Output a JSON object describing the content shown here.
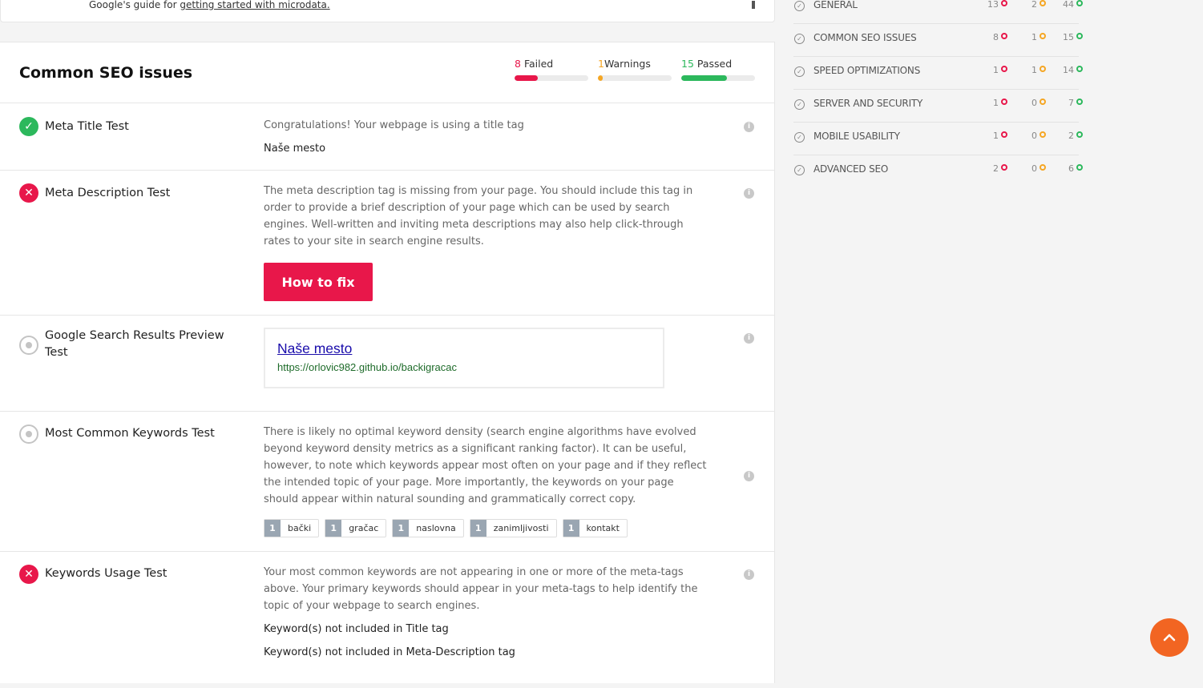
{
  "top_card": {
    "prefix": "Google's guide for ",
    "link": "getting started with microdata."
  },
  "section": {
    "title": "Common SEO issues",
    "stats": {
      "failed": {
        "count": "8",
        "label": "Failed",
        "fraction": 0.32,
        "color": "#e8174a"
      },
      "warnings": {
        "count": "1",
        "label": "Warnings",
        "fraction": 0.06,
        "color": "#f5a623"
      },
      "passed": {
        "count": "15",
        "label": "Passed",
        "fraction": 0.62,
        "color": "#2cb85c"
      }
    }
  },
  "tests": {
    "meta_title": {
      "name": "Meta Title Test",
      "status": "pass",
      "desc": "Congratulations! Your webpage is using a title tag",
      "value": "Naše mesto"
    },
    "meta_desc": {
      "name": "Meta Description Test",
      "status": "fail",
      "desc": "The meta description tag is missing from your page. You should include this tag in order to provide a brief description of your page which can be used by search engines. Well-written and inviting meta descriptions may also help click-through rates to your site in search engine results.",
      "button": "How to fix"
    },
    "serp": {
      "name": "Google Search Results Preview Test",
      "status": "info",
      "title": "Naše mesto",
      "url": "https://orlovic982.github.io/backigracac"
    },
    "keywords": {
      "name": "Most Common Keywords Test",
      "status": "info",
      "desc": "There is likely no optimal keyword density (search engine algorithms have evolved beyond keyword density metrics as a significant ranking factor). It can be useful, however, to note which keywords appear most often on your page and if they reflect the intended topic of your page. More importantly, the keywords on your page should appear within natural sounding and grammatically correct copy.",
      "tags": [
        {
          "count": "1",
          "word": "bački"
        },
        {
          "count": "1",
          "word": "gračac"
        },
        {
          "count": "1",
          "word": "naslovna"
        },
        {
          "count": "1",
          "word": "zanimljivosti"
        },
        {
          "count": "1",
          "word": "kontakt"
        }
      ]
    },
    "keywords_usage": {
      "name": "Keywords Usage Test",
      "status": "fail",
      "desc": "Your most common keywords are not appearing in one or more of the meta-tags above. Your primary keywords should appear in your meta-tags to help identify the topic of your webpage to search engines.",
      "line1": "Keyword(s) not included in Title tag",
      "line2": "Keyword(s) not included in Meta-Description tag"
    }
  },
  "sidebar": {
    "rows": [
      {
        "name": "GENERAL",
        "failed": "13",
        "warnings": "2",
        "passed": "44"
      },
      {
        "name": "COMMON SEO ISSUES",
        "failed": "8",
        "warnings": "1",
        "passed": "15"
      },
      {
        "name": "SPEED OPTIMIZATIONS",
        "failed": "1",
        "warnings": "1",
        "passed": "14"
      },
      {
        "name": "SERVER AND SECURITY",
        "failed": "1",
        "warnings": "0",
        "passed": "7"
      },
      {
        "name": "MOBILE USABILITY",
        "failed": "1",
        "warnings": "0",
        "passed": "2"
      },
      {
        "name": "ADVANCED SEO",
        "failed": "2",
        "warnings": "0",
        "passed": "6"
      }
    ]
  },
  "colors": {
    "failed": "#e8174a",
    "warnings": "#f5a623",
    "passed": "#2cb85c",
    "fab": "#f26522"
  },
  "icons": {
    "scroll_top": "chevron-up-icon",
    "info": "info-icon",
    "check": "check-circle-icon"
  }
}
